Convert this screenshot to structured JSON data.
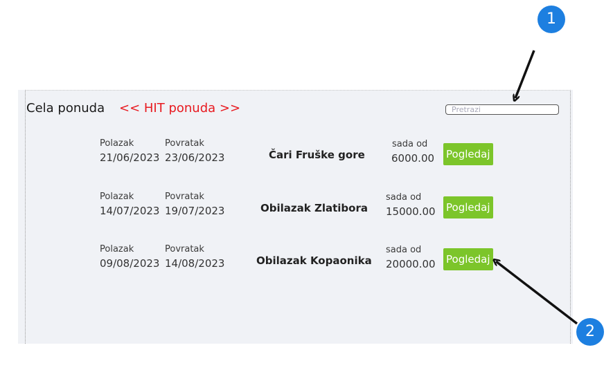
{
  "header": {
    "title": "Cela ponuda",
    "hit_link": "<< HIT ponuda >>"
  },
  "search": {
    "placeholder": "Pretrazi",
    "value": ""
  },
  "offers": [
    {
      "departure_label": "Polazak",
      "departure_date": "21/06/2023",
      "return_label": "Povratak",
      "return_date": "23/06/2023",
      "name": "Čari Fruške gore",
      "price_label": "sada od",
      "price": "6000.00",
      "button_label": "Pogledaj"
    },
    {
      "departure_label": "Polazak",
      "departure_date": "14/07/2023",
      "return_label": "Povratak",
      "return_date": "19/07/2023",
      "name": "Obilazak Zlatibora",
      "price_label": "sada od",
      "price": "15000.00",
      "button_label": "Pogledaj"
    },
    {
      "departure_label": "Polazak",
      "departure_date": "09/08/2023",
      "return_label": "Povratak",
      "return_date": "14/08/2023",
      "name": "Obilazak Kopaonika",
      "price_label": "sada od",
      "price": "20000.00",
      "button_label": "Pogledaj"
    }
  ],
  "annotations": {
    "badge_1": "1",
    "badge_2": "2"
  },
  "colors": {
    "hit_red": "#e8191f",
    "button_green": "#7cc52a",
    "badge_blue": "#1d7fe0",
    "panel_bg": "#f0f2f6"
  }
}
